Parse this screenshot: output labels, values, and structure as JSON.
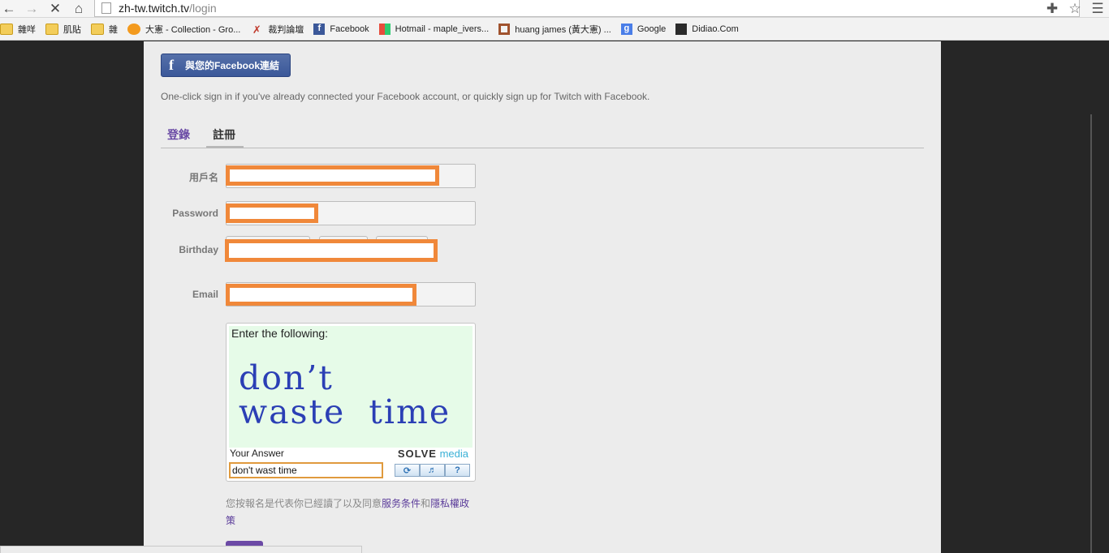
{
  "browser": {
    "url_host": "zh-tw.twitch.tv",
    "url_path": "/login",
    "back_icon": "back-arrow-icon",
    "forward_icon": "forward-arrow-icon",
    "stop_icon": "stop-x-icon",
    "home_icon": "home-icon"
  },
  "bookmarks": [
    {
      "label": "雜咩",
      "icon": "folder-icon"
    },
    {
      "label": "肌貼",
      "icon": "folder-icon"
    },
    {
      "label": "雜",
      "icon": "folder-icon"
    },
    {
      "label": "大憲 - Collection - Gro...",
      "icon": "collection-icon"
    },
    {
      "label": "裁判論壇",
      "icon": "whistle-icon"
    },
    {
      "label": "Facebook",
      "icon": "facebook-icon"
    },
    {
      "label": "Hotmail - maple_ivers...",
      "icon": "windows-icon"
    },
    {
      "label": "huang james (黃大憲) ...",
      "icon": "profile-icon"
    },
    {
      "label": "Google",
      "icon": "google-icon"
    },
    {
      "label": "Didiao.Com",
      "icon": "didiao-icon"
    }
  ],
  "facebook_connect": {
    "button_label": "與您的Facebook連結",
    "note": "One-click sign in if you've already connected your Facebook account, or quickly sign up for Twitch with Facebook."
  },
  "tabs": {
    "login": "登錄",
    "signup": "註冊"
  },
  "form": {
    "username_label": "用戶名",
    "password_label": "Password",
    "birthday_label": "Birthday",
    "email_label": "Email"
  },
  "captcha": {
    "prompt": "Enter the following:",
    "line1": "don’t",
    "line2": "waste time",
    "answer_label": "Your Answer",
    "brand_solve": "SOLVE",
    "brand_media": "media",
    "answer_value": "don't wast time",
    "refresh_icon": "refresh-icon",
    "audio_icon": "speaker-icon",
    "help_label": "?"
  },
  "terms": {
    "prefix": "您按報名是代表你已經讀了以及同意",
    "terms_link": "服务条件",
    "and": "和",
    "privacy_link": "隱私權政策"
  },
  "colors": {
    "twitch_purple": "#6a4aa5",
    "facebook_blue": "#3b5899",
    "redaction_orange": "#f0883a"
  }
}
